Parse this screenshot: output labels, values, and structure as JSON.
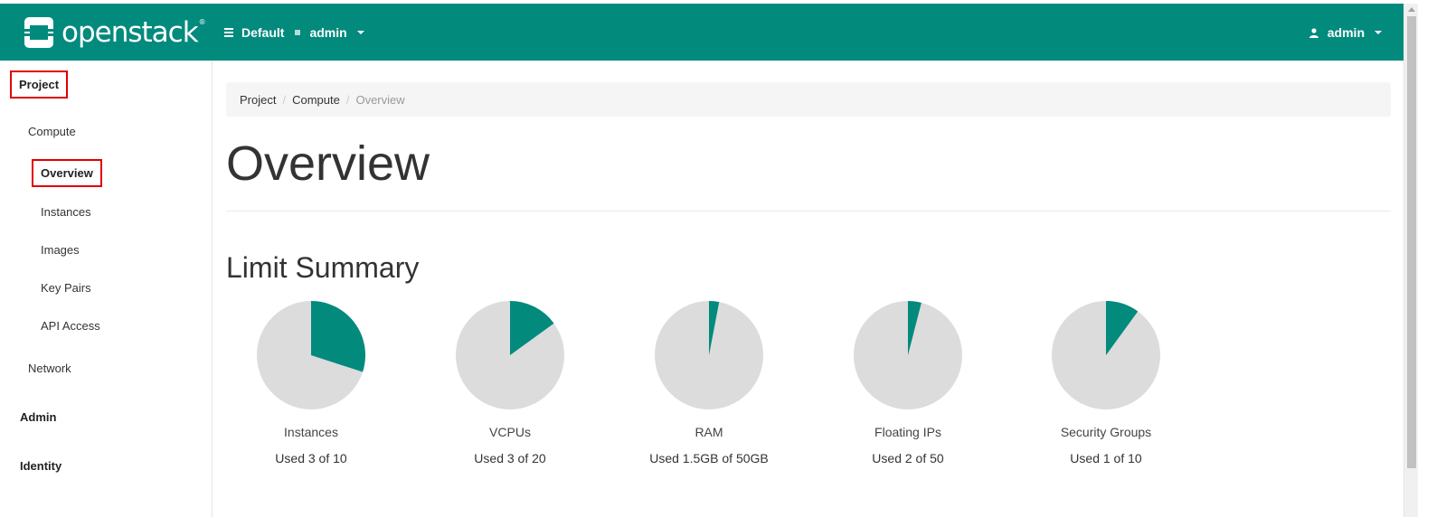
{
  "topbar": {
    "logo_text": "openstack",
    "domain_label": "Default",
    "project_label": "admin",
    "user_label": "admin",
    "bg_color": "#028A7D"
  },
  "sidebar": {
    "project": "Project",
    "compute": "Compute",
    "items": [
      {
        "label": "Overview",
        "active": true
      },
      {
        "label": "Instances"
      },
      {
        "label": "Images"
      },
      {
        "label": "Key Pairs"
      },
      {
        "label": "API Access"
      }
    ],
    "network": "Network",
    "admin": "Admin",
    "identity": "Identity"
  },
  "breadcrumb": [
    "Project",
    "Compute",
    "Overview"
  ],
  "page_title": "Overview",
  "limit_summary": {
    "title": "Limit Summary",
    "fill_color": "#028A7D",
    "empty_color": "#dcdcdc",
    "charts": [
      {
        "label": "Instances",
        "usage": "Used 3 of 10",
        "fraction": 0.3
      },
      {
        "label": "VCPUs",
        "usage": "Used 3 of 20",
        "fraction": 0.15
      },
      {
        "label": "RAM",
        "usage": "Used 1.5GB of 50GB",
        "fraction": 0.03
      },
      {
        "label": "Floating IPs",
        "usage": "Used 2 of 50",
        "fraction": 0.04
      },
      {
        "label": "Security Groups",
        "usage": "Used 1 of 10",
        "fraction": 0.1
      }
    ]
  }
}
